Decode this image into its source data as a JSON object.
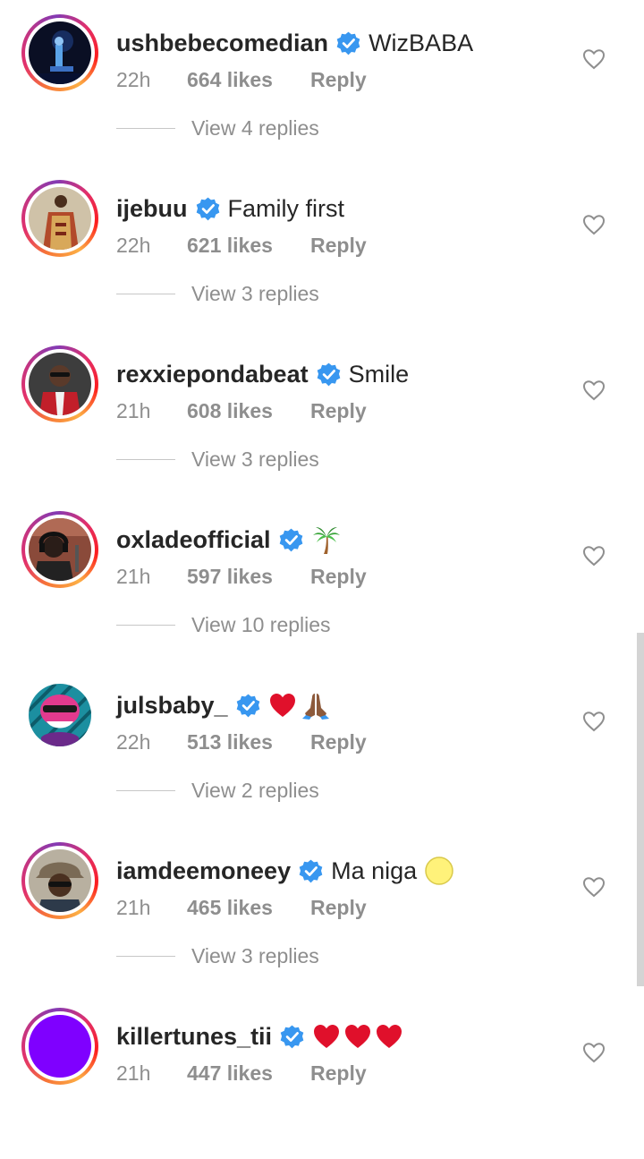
{
  "colors": {
    "text": "#262626",
    "secondary": "#8e8e8e",
    "verified": "#3897f0",
    "heart_emoji": "#e0102b"
  },
  "comments": [
    {
      "username": "ushbebecomedian",
      "text": "WizBABA",
      "time": "22h",
      "likes": "664 likes",
      "reply": "Reply",
      "view_replies": "View 4 replies",
      "avatar": "night-concert-photo",
      "story_ring": true
    },
    {
      "username": "ijebuu",
      "text": "Family first",
      "time": "22h",
      "likes": "621 likes",
      "reply": "Reply",
      "view_replies": "View 3 replies",
      "avatar": "traditional-attire-photo",
      "story_ring": true
    },
    {
      "username": "rexxiepondabeat",
      "text": "Smile",
      "time": "21h",
      "likes": "608 likes",
      "reply": "Reply",
      "view_replies": "View 3 replies",
      "avatar": "red-jacket-photo",
      "story_ring": true
    },
    {
      "username": "oxladeofficial",
      "text": "",
      "emoji": "palm-tree",
      "time": "21h",
      "likes": "597 likes",
      "reply": "Reply",
      "view_replies": "View 10 replies",
      "avatar": "studio-headphones-photo",
      "story_ring": true
    },
    {
      "username": "julsbaby_",
      "text": "",
      "emoji": "red-heart-and-folded-hands",
      "time": "22h",
      "likes": "513 likes",
      "reply": "Reply",
      "view_replies": "View 2 replies",
      "avatar": "cartoon-character-art",
      "story_ring": false
    },
    {
      "username": "iamdeemoneey",
      "text": "Ma niga",
      "emoji": "yellow-circle",
      "time": "21h",
      "likes": "465 likes",
      "reply": "Reply",
      "view_replies": "View 3 replies",
      "avatar": "bucket-hat-photo",
      "story_ring": true
    },
    {
      "username": "killertunes_tii",
      "text": "",
      "emoji": "three-red-hearts",
      "time": "21h",
      "likes": "447 likes",
      "reply": "Reply",
      "avatar": "purple-solid-circle",
      "story_ring": true
    }
  ]
}
